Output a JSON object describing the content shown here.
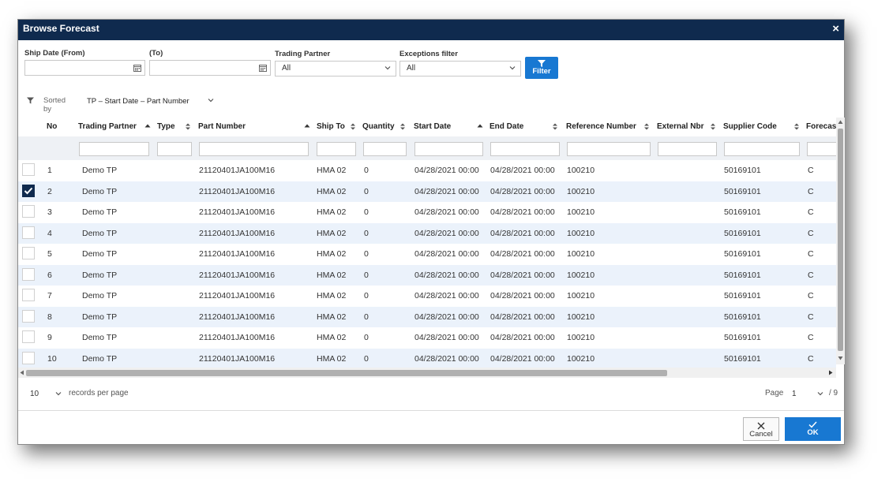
{
  "dialog": {
    "title": "Browse Forecast",
    "close_symbol": "×"
  },
  "filters": {
    "ship_date_from_label": "Ship Date (From)",
    "ship_date_from_value": "",
    "ship_date_to_label": "(To)",
    "ship_date_to_value": "",
    "trading_partner_label": "Trading Partner",
    "trading_partner_value": "All",
    "exceptions_label": "Exceptions filter",
    "exceptions_value": "All",
    "filter_button": "Filter"
  },
  "sort": {
    "label": "Sorted by",
    "value": "TP – Start Date – Part Number"
  },
  "columns": [
    "No",
    "Trading Partner",
    "Type",
    "Part Number",
    "Ship To",
    "Quantity",
    "Start Date",
    "End Date",
    "Reference Number",
    "External Nbr",
    "Supplier Code",
    "Forecas"
  ],
  "rows": [
    {
      "checked": false,
      "no": "1",
      "partner": "Demo TP",
      "type": "",
      "part": "21120401JA100M16",
      "ship_to": "HMA 02",
      "qty": "0",
      "start": "04/28/2021 00:00",
      "end": "04/28/2021 00:00",
      "ref": "100210",
      "ext": "",
      "supplier": "50169101",
      "forecast": "C"
    },
    {
      "checked": true,
      "no": "2",
      "partner": "Demo TP",
      "type": "",
      "part": "21120401JA100M16",
      "ship_to": "HMA 02",
      "qty": "0",
      "start": "04/28/2021 00:00",
      "end": "04/28/2021 00:00",
      "ref": "100210",
      "ext": "",
      "supplier": "50169101",
      "forecast": "C"
    },
    {
      "checked": false,
      "no": "3",
      "partner": "Demo TP",
      "type": "",
      "part": "21120401JA100M16",
      "ship_to": "HMA 02",
      "qty": "0",
      "start": "04/28/2021 00:00",
      "end": "04/28/2021 00:00",
      "ref": "100210",
      "ext": "",
      "supplier": "50169101",
      "forecast": "C"
    },
    {
      "checked": false,
      "no": "4",
      "partner": "Demo TP",
      "type": "",
      "part": "21120401JA100M16",
      "ship_to": "HMA 02",
      "qty": "0",
      "start": "04/28/2021 00:00",
      "end": "04/28/2021 00:00",
      "ref": "100210",
      "ext": "",
      "supplier": "50169101",
      "forecast": "C"
    },
    {
      "checked": false,
      "no": "5",
      "partner": "Demo TP",
      "type": "",
      "part": "21120401JA100M16",
      "ship_to": "HMA 02",
      "qty": "0",
      "start": "04/28/2021 00:00",
      "end": "04/28/2021 00:00",
      "ref": "100210",
      "ext": "",
      "supplier": "50169101",
      "forecast": "C"
    },
    {
      "checked": false,
      "no": "6",
      "partner": "Demo TP",
      "type": "",
      "part": "21120401JA100M16",
      "ship_to": "HMA 02",
      "qty": "0",
      "start": "04/28/2021 00:00",
      "end": "04/28/2021 00:00",
      "ref": "100210",
      "ext": "",
      "supplier": "50169101",
      "forecast": "C"
    },
    {
      "checked": false,
      "no": "7",
      "partner": "Demo TP",
      "type": "",
      "part": "21120401JA100M16",
      "ship_to": "HMA 02",
      "qty": "0",
      "start": "04/28/2021 00:00",
      "end": "04/28/2021 00:00",
      "ref": "100210",
      "ext": "",
      "supplier": "50169101",
      "forecast": "C"
    },
    {
      "checked": false,
      "no": "8",
      "partner": "Demo TP",
      "type": "",
      "part": "21120401JA100M16",
      "ship_to": "HMA 02",
      "qty": "0",
      "start": "04/28/2021 00:00",
      "end": "04/28/2021 00:00",
      "ref": "100210",
      "ext": "",
      "supplier": "50169101",
      "forecast": "C"
    },
    {
      "checked": false,
      "no": "9",
      "partner": "Demo TP",
      "type": "",
      "part": "21120401JA100M16",
      "ship_to": "HMA 02",
      "qty": "0",
      "start": "04/28/2021 00:00",
      "end": "04/28/2021 00:00",
      "ref": "100210",
      "ext": "",
      "supplier": "50169101",
      "forecast": "C"
    },
    {
      "checked": false,
      "no": "10",
      "partner": "Demo TP",
      "type": "",
      "part": "21120401JA100M16",
      "ship_to": "HMA 02",
      "qty": "0",
      "start": "04/28/2021 00:00",
      "end": "04/28/2021 00:00",
      "ref": "100210",
      "ext": "",
      "supplier": "50169101",
      "forecast": "C"
    }
  ],
  "pager": {
    "page_size": "10",
    "records_label": "records per page",
    "page_label": "Page",
    "current_page": "1",
    "total_pages": "/ 9"
  },
  "buttons": {
    "cancel": "Cancel",
    "ok": "OK"
  },
  "colors": {
    "titlebar": "#0f2a4e",
    "accent": "#1878d2",
    "row_alt": "#ebf2fb"
  }
}
